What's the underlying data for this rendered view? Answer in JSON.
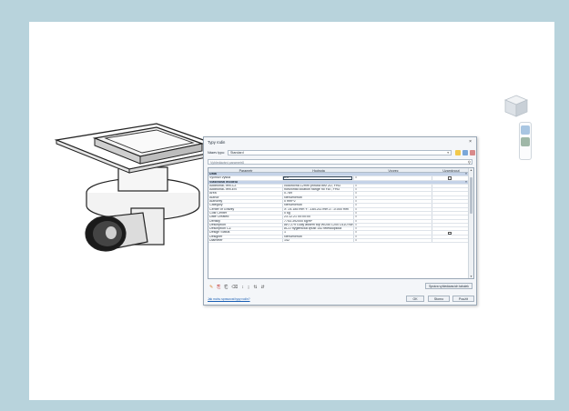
{
  "dialog": {
    "title": "Typy rodin",
    "close_glyph": "×",
    "name_label": "Název typu:",
    "type_name": "Standard",
    "search_placeholder": "Vyhledávání parametrů",
    "columns": [
      "Parametr",
      "Hodnota",
      "Vzorec",
      "Uzamknout"
    ],
    "groups": [
      {
        "title": "Data",
        "rows": [
          {
            "param": "Výchozí výška",
            "value": "0,0",
            "formula": "=",
            "lock": true
          }
        ]
      },
      {
        "title": "Vlastnosti modelu",
        "rows": [
          {
            "param": "Additional-Text-CZ",
            "value": "vodorovná 12mm příruba bez ZU, FHD",
            "formula": "=",
            "lock": false
          },
          {
            "param": "Additional-Text-EN",
            "value": "horizontal location flange no FAT, FHD",
            "formula": "=",
            "lock": false
          },
          {
            "param": "Area",
            "value": "0.789",
            "formula": "=",
            "lock": false
          },
          {
            "param": "Author",
            "value": "Nenumírnuti",
            "formula": "=",
            "lock": false
          },
          {
            "param": "Authority",
            "value": "0 mm^2",
            "formula": "=",
            "lock": false
          },
          {
            "param": "Category",
            "value": "Nenumírnuti",
            "formula": "=",
            "lock": false
          },
          {
            "param": "Center of Gravity",
            "value": "X: 24.185 mm Y: -184.211 mm Z: -0.000 mm",
            "formula": "=",
            "lock": false
          },
          {
            "param": "Cost Center",
            "value": "0 kg",
            "formula": "=",
            "lock": false
          },
          {
            "param": "Date Created",
            "value": "23.12.21 00:00:00",
            "formula": "=",
            "lock": false
          },
          {
            "param": "Density",
            "value": "7753.392000 kg/m³",
            "formula": "=",
            "lock": false
          },
          {
            "param": "Description",
            "value": "AKT279 Gully assem top W/250 L200 D110 hor",
            "formula": "=",
            "lock": false
          },
          {
            "param": "Description CZ",
            "value": "ACO hygienická vpust 142 teleskopická",
            "formula": "=",
            "lock": false
          },
          {
            "param": "Design Status",
            "value": "1",
            "formula": "=",
            "lock": true
          },
          {
            "param": "Designer",
            "value": "Nenumírnuti",
            "formula": "=",
            "lock": false
          },
          {
            "param": "Diameter",
            "value": "142",
            "formula": "=",
            "lock": false
          }
        ]
      }
    ],
    "group_toggle": "«",
    "tool_icons": [
      "pencil-icon",
      "new-type-icon",
      "rename-icon",
      "delete-icon",
      "sort-up-icon",
      "sort-down-icon",
      "move-up-icon",
      "move-down-icon"
    ],
    "tool_glyphs": [
      "✎",
      "⎘",
      "⎗",
      "⌫",
      "↕",
      "↨",
      "⇅",
      "⇵"
    ],
    "manage_tables_label": "Správa vyhledávacích tabulek",
    "help_link": "Jak mohu spravovat typy rodin?",
    "ok_label": "OK",
    "cancel_label": "Storno",
    "apply_label": "Použít"
  },
  "viewport": {
    "viewcube_icon": "viewcube-icon",
    "nav_icons": [
      "steering-wheel-icon",
      "zoom-icon"
    ]
  },
  "colors": {
    "frame": "#b8d3dc",
    "group_header": "#c5d3e8",
    "link": "#1a5fb4"
  }
}
